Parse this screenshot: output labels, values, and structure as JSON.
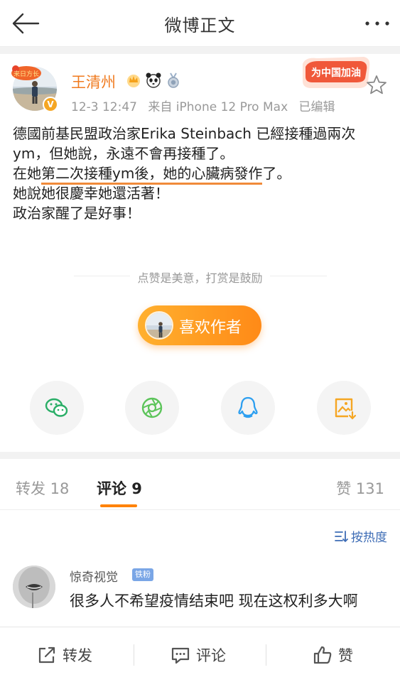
{
  "header": {
    "title": "微博正文"
  },
  "post": {
    "author": "王清州",
    "time": "12-3 12:47",
    "source": "来自 iPhone 12 Pro Max",
    "edited": "已编辑",
    "promo_text": "为中国加油",
    "pendant_text": "来日方长",
    "text_line1": "德國前基民盟政治家Erika Steinbach 已經接種過兩次ym，但她說，永遠不會再接種了。",
    "text_line2_a": "在她",
    "text_line2_b": "第二次接種ym後，她的心臟病發作",
    "text_line2_c": "了。",
    "text_line3": "她說她很慶幸她還活著！",
    "text_line4": "政治家醒了是好事！"
  },
  "reward": {
    "tip": "点赞是美意，打赏是鼓励",
    "like_author": "喜欢作者"
  },
  "share": {
    "icons": [
      "wechat-icon",
      "moments-icon",
      "qq-icon",
      "save-image-icon"
    ]
  },
  "tabs": {
    "repost": "转发 18",
    "comment": "评论 9",
    "like": "赞 131"
  },
  "sort": {
    "label": "按热度"
  },
  "comment": {
    "username": "惊奇视觉",
    "fan_badge": "铁粉",
    "text": "很多人不希望疫情结束吧 现在这权利多大啊"
  },
  "bottombar": {
    "repost": "转发",
    "comment": "评论",
    "like": "赞"
  },
  "colors": {
    "accent": "#ff8200",
    "username": "#f07a1e",
    "link": "#3d6cb5",
    "highlight_underline": "#f08a3a"
  }
}
